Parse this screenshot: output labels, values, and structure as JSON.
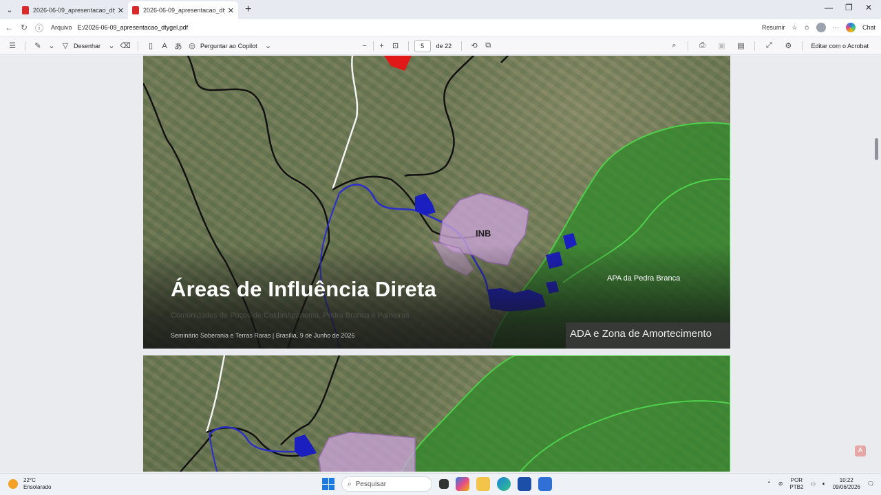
{
  "tabs": [
    {
      "title": "2026-06-09_apresentacao_dtygel",
      "active": false
    },
    {
      "title": "2026-06-09_apresentacao_dtygel",
      "active": true
    }
  ],
  "address": {
    "file_label": "Arquivo",
    "url": "E:/2026-06-09_apresentacao_dtygel.pdf",
    "summarize_label": "Resumir",
    "chat_label": "Chat"
  },
  "pdf_toolbar": {
    "draw_label": "Desenhar",
    "copilot_label": "Perguntar ao Copilot",
    "current_page": "5",
    "total_pages": "de 22",
    "acrobat_label": "Editar com o Acrobat"
  },
  "slide": {
    "title": "Áreas de Influência Direta",
    "subtitle": "Comunidades de Poços de Caldas/Ipanema, Pedra Branca e Paineiras",
    "footer": "Seminário Soberania e Terras Raras | Brasília, 9 de Junho de 2026",
    "legend": "ADA e Zona de Amortecimento",
    "label_inb": "INB",
    "label_apa": "APA da Pedra Branca"
  },
  "taskbar": {
    "temperature": "22°C",
    "weather": "Ensolarado",
    "search_placeholder": "Pesquisar",
    "lang_top": "POR",
    "lang_bottom": "PTB2",
    "time": "10:22",
    "date": "09/06/2026"
  },
  "colors": {
    "blue_area": "#1c1fbf",
    "pink_area": "#c9a3d6",
    "green_zone": "#2f8a2a",
    "red_area": "#e01818"
  }
}
